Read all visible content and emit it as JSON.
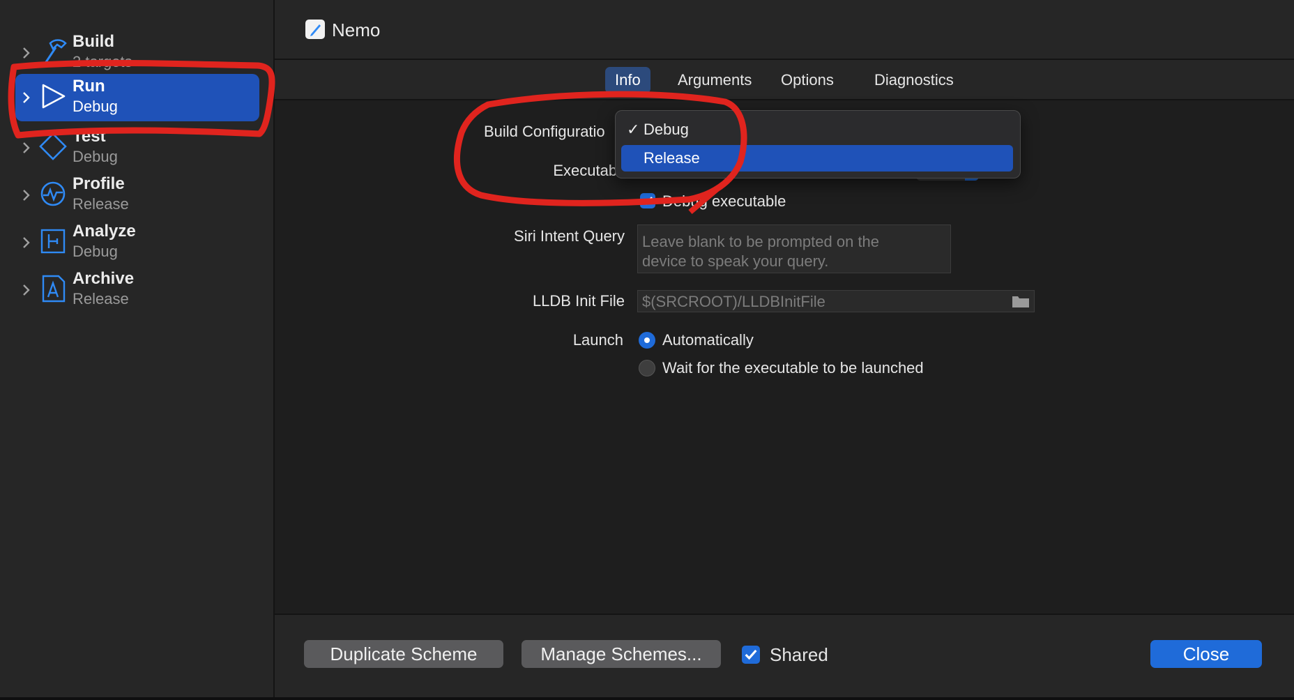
{
  "sidebar": {
    "actions": [
      {
        "title": "Build",
        "subtitle": "2 targets",
        "icon": "hammer-icon"
      },
      {
        "title": "Run",
        "subtitle": "Debug",
        "icon": "play-icon"
      },
      {
        "title": "Test",
        "subtitle": "Debug",
        "icon": "test-diamond-icon"
      },
      {
        "title": "Profile",
        "subtitle": "Release",
        "icon": "profile-gauge-icon"
      },
      {
        "title": "Analyze",
        "subtitle": "Debug",
        "icon": "analyze-icon"
      },
      {
        "title": "Archive",
        "subtitle": "Release",
        "icon": "archive-icon"
      }
    ]
  },
  "header": {
    "scheme_name": "Nemo",
    "icon": "scheme-pencil-icon"
  },
  "tabs": [
    "Info",
    "Arguments",
    "Options",
    "Diagnostics"
  ],
  "form": {
    "build_configuration_label": "Build Configuratio",
    "executable_label": "Executabl",
    "debug_executable_label": "Debug executable",
    "siri_label": "Siri Intent Query",
    "siri_placeholder_line1": "Leave blank to be prompted on the",
    "siri_placeholder_line2": "device to speak your query.",
    "lldb_label": "LLDB Init File",
    "lldb_placeholder": "$(SRCROOT)/LLDBInitFile",
    "launch_label": "Launch",
    "launch_options": [
      "Automatically",
      "Wait for the executable to be launched"
    ]
  },
  "dropdown": {
    "check_mark": "✓",
    "items": [
      "Debug",
      "Release"
    ]
  },
  "footer": {
    "duplicate": "Duplicate Scheme",
    "manage": "Manage Schemes...",
    "shared": "Shared",
    "close": "Close"
  },
  "colors": {
    "accent": "#1f6bd9",
    "selection": "#1f52b8",
    "annotation": "#e0241e"
  }
}
